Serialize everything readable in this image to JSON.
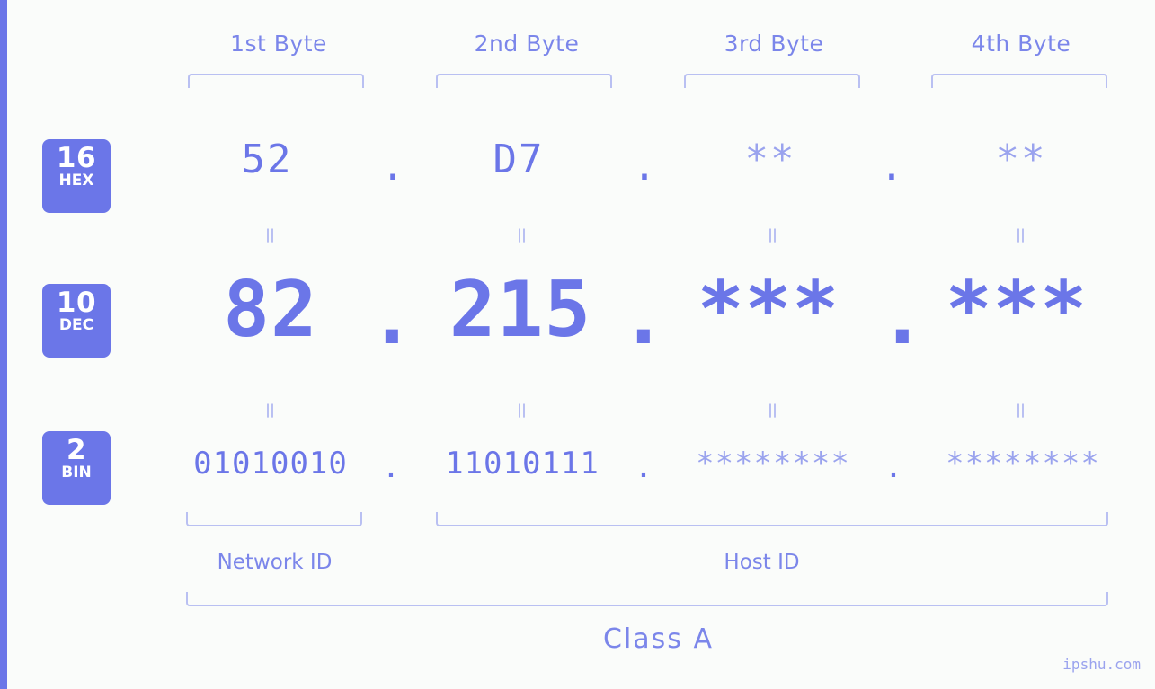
{
  "accent": "#6b76e8",
  "accent_light": "#9aa3ee",
  "brace_color": "#b9c0f2",
  "background": "#fafcfa",
  "headers": {
    "byte1": "1st Byte",
    "byte2": "2nd Byte",
    "byte3": "3rd Byte",
    "byte4": "4th Byte"
  },
  "radix": [
    {
      "num": "16",
      "name": "HEX"
    },
    {
      "num": "10",
      "name": "DEC"
    },
    {
      "num": "2",
      "name": "BIN"
    }
  ],
  "rows": {
    "hex": [
      "52",
      "D7",
      "**",
      "**"
    ],
    "dec": [
      "82",
      "215",
      "***",
      "***"
    ],
    "bin": [
      "01010010",
      "11010111",
      "********",
      "********"
    ]
  },
  "separator": ".",
  "equals": "=",
  "ids": {
    "network": "Network ID",
    "host": "Host ID"
  },
  "class_label": "Class A",
  "watermark": "ipshu.com"
}
